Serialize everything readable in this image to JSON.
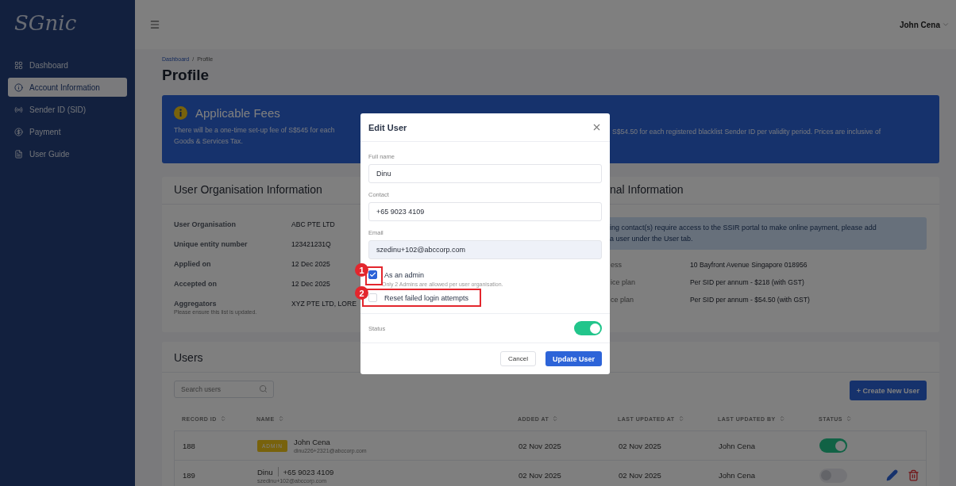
{
  "sidebar": {
    "logo": "SGnic",
    "items": [
      {
        "label": "Dashboard",
        "kind": "dashboard",
        "selected": false
      },
      {
        "label": "Account Information",
        "kind": "info",
        "selected": true
      },
      {
        "label": "Sender ID  (SID)",
        "kind": "sender",
        "selected": false
      },
      {
        "label": "Payment",
        "kind": "payment",
        "selected": false
      },
      {
        "label": "User Guide",
        "kind": "guide",
        "selected": false
      }
    ]
  },
  "topbar": {
    "user": "John Cena"
  },
  "breadcrumb": [
    {
      "label": "Dashboard",
      "link": true
    },
    {
      "label": "/",
      "link": false
    },
    {
      "label": "Profile",
      "link": false
    }
  ],
  "page_title": "Profile",
  "fees": {
    "title": "Applicable Fees",
    "text_left": "There will be a one-time set-up fee of S$545 for each",
    "text_right": "S$54.50 for each registered blacklist Sender ID per validity period. Prices are inclusive of",
    "text_line2": "Goods & Services Tax."
  },
  "org_card": {
    "title": "User Organisation Information",
    "rows": [
      {
        "label": "User Organisation",
        "value": "ABC PTE LTD"
      },
      {
        "label": "Unique entity number",
        "value": "123421231Q"
      },
      {
        "label": "Applied on",
        "value": "12 Dec 2025"
      },
      {
        "label": "Accepted on",
        "value": "12 Dec 2025"
      },
      {
        "label": "Aggregators",
        "value": "XYZ PTE LTD, LORE",
        "note": "Please ensure this list is updated."
      }
    ]
  },
  "info_card": {
    "title": "nal Information",
    "alert": "ing contact(s) require access to the SSIR portal to make online payment, please add",
    "alert_line2": "a user under the User tab.",
    "rows": [
      {
        "label": "ess",
        "value": "10 Bayfront Avenue Singapore 018956"
      },
      {
        "label": "ice plan",
        "value": "Per SID per annum - $218 (with GST)"
      },
      {
        "label": "ce plan",
        "value": "Per SID per annum - $54.50 (with GST)"
      }
    ]
  },
  "users": {
    "title": "Users",
    "search": {
      "placeholder": "Search users"
    },
    "create_button": "+ Create New User",
    "columns": [
      "RECORD ID",
      "NAME",
      "ADDED AT",
      "LAST UPDATED AT",
      "LAST UPDATED BY",
      "STATUS"
    ],
    "rows": [
      {
        "id": "188",
        "badge": "ADMIN",
        "name": "John Cena",
        "email": "dinu226+2321@abccorp.com",
        "added": "02 Nov 2025",
        "updated": "02 Nov 2025",
        "updated_by": "John Cena",
        "on": true,
        "actions": false
      },
      {
        "id": "189",
        "name": "Dinu",
        "contact": "+65 9023 4109",
        "email": "szedinu+102@abccorp.com",
        "added": "02 Nov 2025",
        "updated": "02 Nov 2025",
        "updated_by": "John Cena",
        "on": false,
        "actions": true
      }
    ]
  },
  "modal": {
    "title": "Edit User",
    "fields": [
      {
        "label": "Full name",
        "value": "Dinu",
        "disabled": false
      },
      {
        "label": "Contact",
        "value": "+65 9023 4109",
        "disabled": false
      },
      {
        "label": "Email",
        "value": "szedinu+102@abccorp.com",
        "disabled": true
      }
    ],
    "checks": [
      {
        "label": "As an admin",
        "checked": true,
        "hint": "Only 2 Admins are allowed per user organisation.",
        "marker": "1"
      },
      {
        "label": "Reset failed login attempts",
        "checked": false,
        "marker": "2"
      }
    ],
    "status": {
      "label": "Status",
      "on": true
    },
    "buttons": [
      {
        "label": "Cancel",
        "primary": false
      },
      {
        "label": "Update User",
        "primary": true
      }
    ]
  }
}
